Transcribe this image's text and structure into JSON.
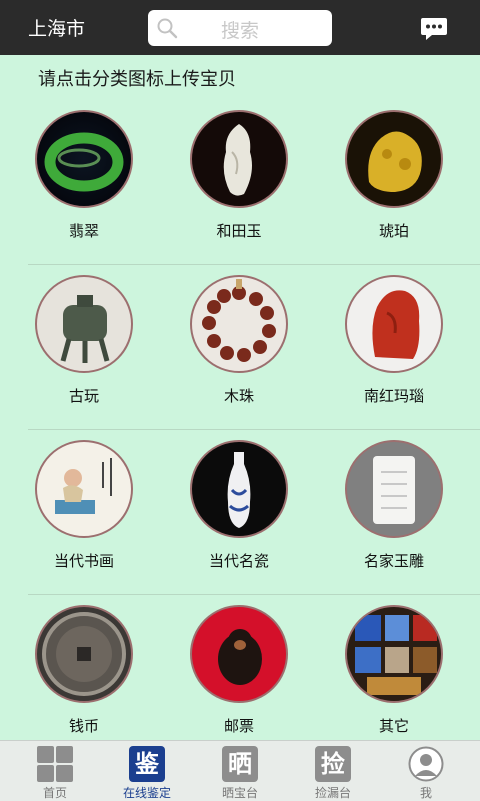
{
  "header": {
    "city": "上海市",
    "search_placeholder": "搜索"
  },
  "prompt": "请点击分类图标上传宝贝",
  "categories": [
    {
      "label": "翡翠"
    },
    {
      "label": "和田玉"
    },
    {
      "label": "琥珀"
    },
    {
      "label": "古玩"
    },
    {
      "label": "木珠"
    },
    {
      "label": "南红玛瑙"
    },
    {
      "label": "当代书画"
    },
    {
      "label": "当代名瓷"
    },
    {
      "label": "名家玉雕"
    },
    {
      "label": "钱币"
    },
    {
      "label": "邮票"
    },
    {
      "label": "其它"
    }
  ],
  "tabs": [
    {
      "label": "首页",
      "glyph": ""
    },
    {
      "label": "在线鉴定",
      "glyph": "鉴"
    },
    {
      "label": "晒宝台",
      "glyph": "晒"
    },
    {
      "label": "捡漏台",
      "glyph": "捡"
    },
    {
      "label": "我",
      "glyph": ""
    }
  ],
  "colors": {
    "topbar": "#2b2b2b",
    "background": "#cdf5dd",
    "active_tab": "#1b3f8f",
    "inactive_tab": "#8d8d8d"
  }
}
